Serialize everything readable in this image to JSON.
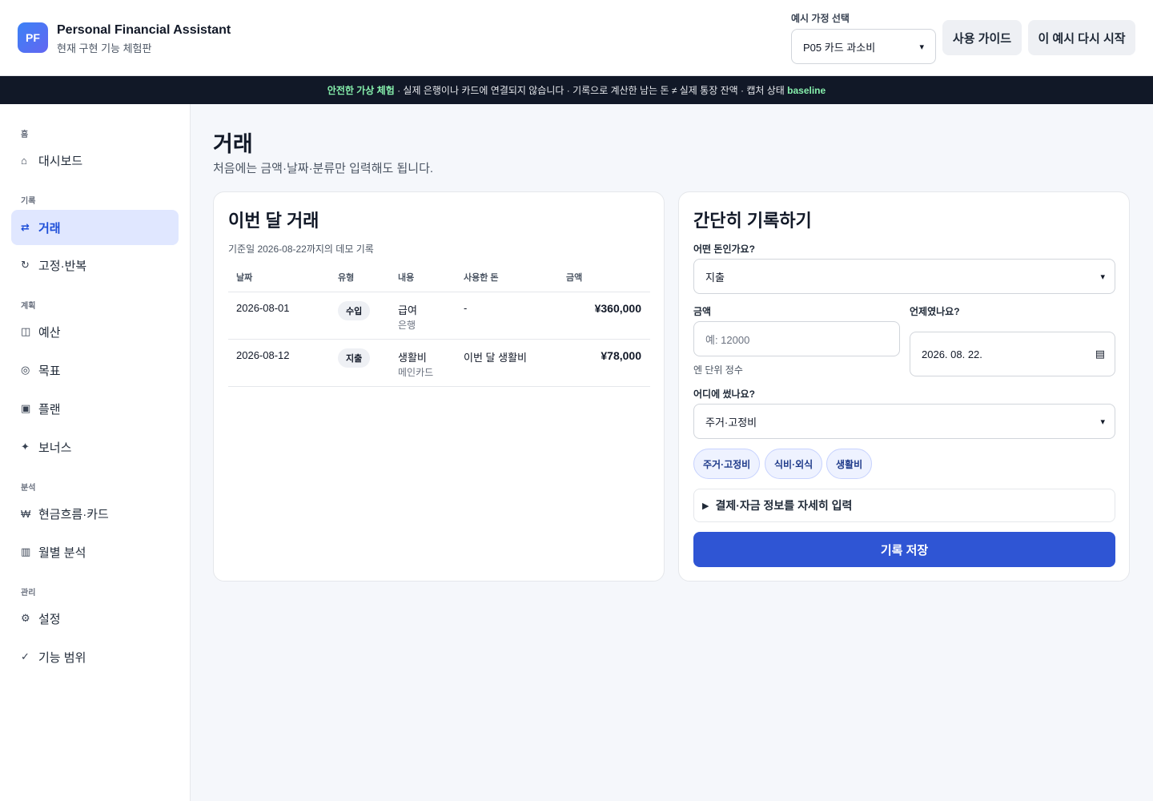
{
  "header": {
    "logo_text": "PF",
    "app_title": "Personal Financial Assistant",
    "app_subtitle": "현재 구현 기능 체험판",
    "household_label": "예시 가정 선택",
    "household_value": "P05 카드 과소비",
    "guide_button": "사용 가이드",
    "restart_button": "이 예시 다시 시작"
  },
  "banner": {
    "accent": "안전한 가상 체험",
    "text": " · 실제 은행이나 카드에 연결되지 않습니다 · 기록으로 계산한 남는 돈 ≠ 실제 통장 잔액 · 캡처 상태 ",
    "state": "baseline"
  },
  "sidebar": {
    "sections": [
      {
        "label": "홈",
        "items": [
          {
            "icon": "⌂",
            "label": "대시보드",
            "active": false
          }
        ]
      },
      {
        "label": "기록",
        "items": [
          {
            "icon": "⇄",
            "label": "거래",
            "active": true
          },
          {
            "icon": "↻",
            "label": "고정·반복",
            "active": false
          }
        ]
      },
      {
        "label": "계획",
        "items": [
          {
            "icon": "◫",
            "label": "예산",
            "active": false
          },
          {
            "icon": "◎",
            "label": "목표",
            "active": false
          },
          {
            "icon": "▣",
            "label": "플랜",
            "active": false
          },
          {
            "icon": "✦",
            "label": "보너스",
            "active": false
          }
        ]
      },
      {
        "label": "분석",
        "items": [
          {
            "icon": "₩",
            "label": "현금흐름·카드",
            "active": false
          },
          {
            "icon": "▥",
            "label": "월별 분석",
            "active": false
          }
        ]
      },
      {
        "label": "관리",
        "items": [
          {
            "icon": "⚙",
            "label": "설정",
            "active": false
          },
          {
            "icon": "✓",
            "label": "기능 범위",
            "active": false
          }
        ]
      }
    ]
  },
  "main": {
    "title": "거래",
    "subtitle": "처음에는 금액·날짜·분류만 입력해도 됩니다."
  },
  "transactions": {
    "title": "이번 달 거래",
    "note": "기준일 2026-08-22까지의 데모 기록",
    "columns": [
      "날짜",
      "유형",
      "내용",
      "사용한 돈",
      "금액"
    ],
    "rows": [
      {
        "date": "2026-08-01",
        "type": "수입",
        "content": "급여",
        "content_sub": "은행",
        "spent": "-",
        "amount": "¥360,000"
      },
      {
        "date": "2026-08-12",
        "type": "지출",
        "content": "생활비",
        "content_sub": "메인카드",
        "spent": "이번 달 생활비",
        "amount": "¥78,000"
      }
    ]
  },
  "quick_form": {
    "title": "간단히 기록하기",
    "kind_label": "어떤 돈인가요?",
    "kind_value": "지출",
    "amount_label": "금액",
    "amount_placeholder": "예: 12000",
    "amount_help": "엔 단위 정수",
    "date_label": "언제였나요?",
    "date_value": "2026. 08. 22.",
    "category_label": "어디에 썼나요?",
    "category_value": "주거·고정비",
    "chips": [
      "주거·고정비",
      "식비·외식",
      "생활비"
    ],
    "details_toggle": "결제·자금 정보를 자세히 입력",
    "save_button": "기록 저장"
  }
}
